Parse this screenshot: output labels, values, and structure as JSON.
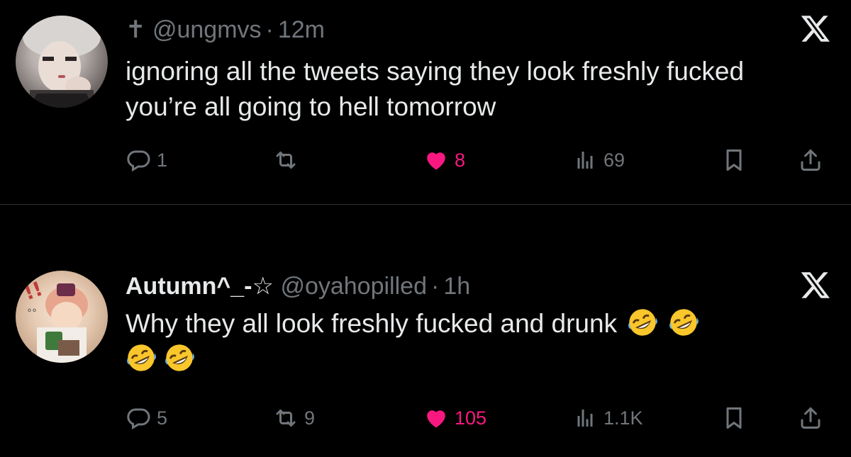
{
  "tweets": [
    {
      "handle_prefix": "✝",
      "handle": "@ungmvs",
      "separator": "·",
      "time": "12m",
      "text": "ignoring all the tweets saying they look freshly fucked you’re all going to hell tomorrow",
      "stats": {
        "replies": "1",
        "retweets": "",
        "likes": "8",
        "views": "69"
      },
      "liked": true
    },
    {
      "display_name": "Autumn^_-☆",
      "handle": "@oyahopilled",
      "separator": "·",
      "time": "1h",
      "text": "Why they all look freshly fucked and drunk",
      "emojis": [
        "rofl-emoji",
        "rofl-emoji",
        "rofl-emoji",
        "rofl-emoji"
      ],
      "stats": {
        "replies": "5",
        "retweets": "9",
        "likes": "105",
        "views": "1.1K"
      },
      "liked": true
    }
  ],
  "colors": {
    "background": "#000000",
    "text": "#e7e9ea",
    "muted": "#71767b",
    "like": "#f91880",
    "divider": "#2f3336"
  }
}
